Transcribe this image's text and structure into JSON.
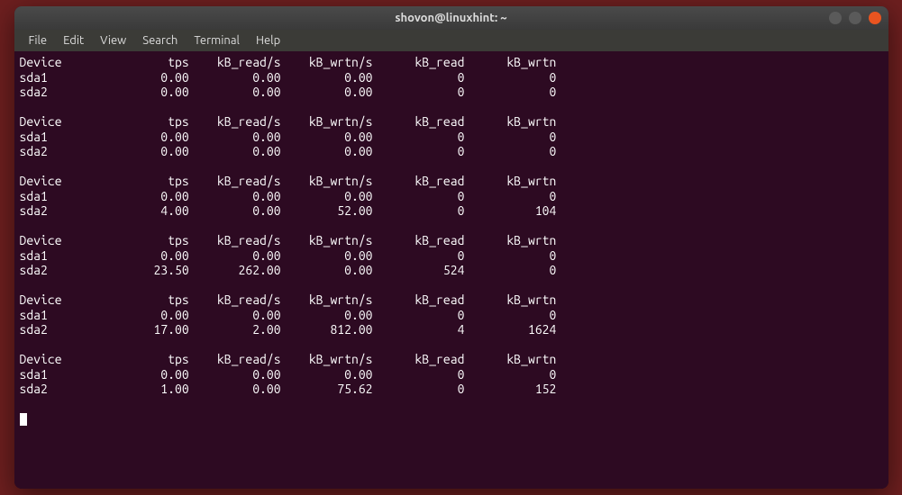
{
  "window": {
    "title": "shovon@linuxhint: ~"
  },
  "menubar": {
    "items": [
      "File",
      "Edit",
      "View",
      "Search",
      "Terminal",
      "Help"
    ]
  },
  "columns": [
    "Device",
    "tps",
    "kB_read/s",
    "kB_wrtn/s",
    "kB_read",
    "kB_wrtn"
  ],
  "blocks": [
    {
      "rows": [
        {
          "device": "sda1",
          "tps": "0.00",
          "kbrs": "0.00",
          "kbws": "0.00",
          "kbr": "0",
          "kbw": "0"
        },
        {
          "device": "sda2",
          "tps": "0.00",
          "kbrs": "0.00",
          "kbws": "0.00",
          "kbr": "0",
          "kbw": "0"
        }
      ]
    },
    {
      "rows": [
        {
          "device": "sda1",
          "tps": "0.00",
          "kbrs": "0.00",
          "kbws": "0.00",
          "kbr": "0",
          "kbw": "0"
        },
        {
          "device": "sda2",
          "tps": "0.00",
          "kbrs": "0.00",
          "kbws": "0.00",
          "kbr": "0",
          "kbw": "0"
        }
      ]
    },
    {
      "rows": [
        {
          "device": "sda1",
          "tps": "0.00",
          "kbrs": "0.00",
          "kbws": "0.00",
          "kbr": "0",
          "kbw": "0"
        },
        {
          "device": "sda2",
          "tps": "4.00",
          "kbrs": "0.00",
          "kbws": "52.00",
          "kbr": "0",
          "kbw": "104"
        }
      ]
    },
    {
      "rows": [
        {
          "device": "sda1",
          "tps": "0.00",
          "kbrs": "0.00",
          "kbws": "0.00",
          "kbr": "0",
          "kbw": "0"
        },
        {
          "device": "sda2",
          "tps": "23.50",
          "kbrs": "262.00",
          "kbws": "0.00",
          "kbr": "524",
          "kbw": "0"
        }
      ]
    },
    {
      "rows": [
        {
          "device": "sda1",
          "tps": "0.00",
          "kbrs": "0.00",
          "kbws": "0.00",
          "kbr": "0",
          "kbw": "0"
        },
        {
          "device": "sda2",
          "tps": "17.00",
          "kbrs": "2.00",
          "kbws": "812.00",
          "kbr": "4",
          "kbw": "1624"
        }
      ]
    },
    {
      "rows": [
        {
          "device": "sda1",
          "tps": "0.00",
          "kbrs": "0.00",
          "kbws": "0.00",
          "kbr": "0",
          "kbw": "0"
        },
        {
          "device": "sda2",
          "tps": "1.00",
          "kbrs": "0.00",
          "kbws": "75.62",
          "kbr": "0",
          "kbw": "152"
        }
      ]
    }
  ]
}
